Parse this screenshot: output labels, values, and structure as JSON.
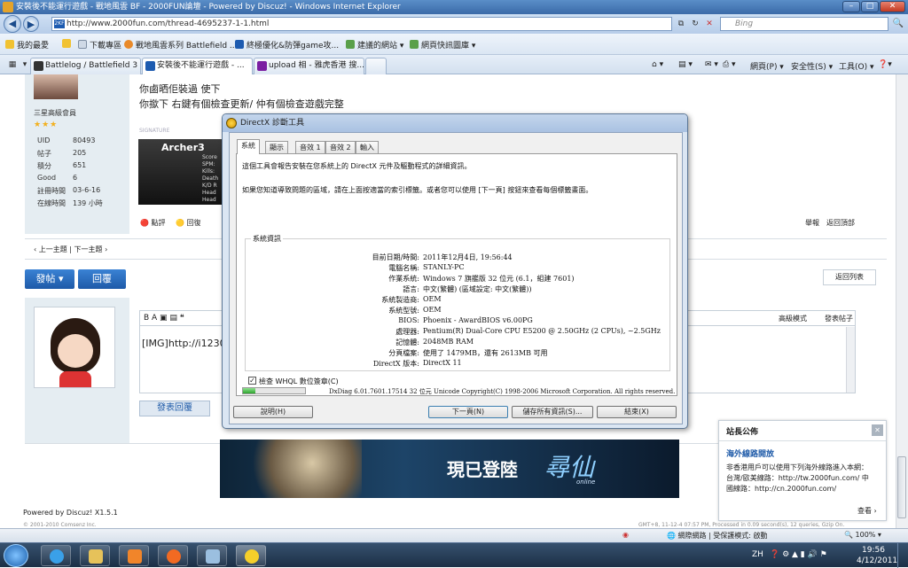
{
  "browser": {
    "title": "安裝後不能運行遊戲 - 戰地風雲 BF - 2000FUN論壇 - Powered by Discuz! - Windows Internet Explorer",
    "window_buttons": {
      "minimize": "–",
      "maximize": "□",
      "close": "✕"
    },
    "address": "http://www.2000fun.com/thread-4695237-1-1.html",
    "address_favicon": "2KF",
    "search_placeholder": "Bing",
    "favorites": [
      {
        "label": "我的最愛"
      },
      {
        "label": "下載專區"
      },
      {
        "label": "戰地風雲系列 Battlefield ..."
      },
      {
        "label": "終極優化&防彈game攻..."
      },
      {
        "label": "建議的網站 ▾"
      },
      {
        "label": "網頁快訊圖庫 ▾"
      }
    ],
    "tabs": [
      {
        "label": "Battlelog / Battlefield 3"
      },
      {
        "label": "安裝後不能運行遊戲 - ..."
      },
      {
        "label": "upload 相 - 雅虎香港 搜..."
      }
    ],
    "tools": {
      "page": "網頁(P) ▾",
      "safety": "安全性(S) ▾",
      "tools": "工具(O) ▾",
      "help": "❓▾"
    }
  },
  "forum": {
    "post_text_1": "你鹵晒佢裝過 使下",
    "post_text_2": "你撳下 右鍵有個檢查更新/ 仲有個檢查遊戲完整",
    "user_rank": "三星高級會員",
    "stars": "★★★",
    "stats": [
      {
        "k": "UID",
        "v": "80493"
      },
      {
        "k": "帖子",
        "v": "205"
      },
      {
        "k": "積分",
        "v": "651"
      },
      {
        "k": "Good",
        "v": "6"
      },
      {
        "k": "註冊時間",
        "v": "03-6-16"
      },
      {
        "k": "在線時間",
        "v": "139 小時"
      }
    ],
    "signature_label": "SIGNATURE",
    "sig_name": "Archer3",
    "sig_lines": [
      "Score",
      "SPM:",
      "Kills:",
      "Death",
      "K/D R",
      "Head",
      "Head"
    ],
    "rate": "點評",
    "reply_action": "回復",
    "report": "舉報",
    "back_top": "返回頂部",
    "prev_next": "‹ 上一主題 | 下一主題 ›",
    "post_btn": "發帖 ▾",
    "reply_btn": "回覆",
    "back_list": "返回列表",
    "editor_toolbar": "B A ▣ ▤ ❝",
    "advanced": "高級模式",
    "send": "發表帖子",
    "editor_text": "[IMG]http://i1230",
    "submit_reply": "發表回覆",
    "powered": "Powered by Discuz! X1.5.1",
    "copyright": "© 2001-2010 Comsenz Inc.",
    "gmt": "GMT+8, 11-12-4 07:57 PM, Processed in 0.09 second(s), 12 queries, Gzip On."
  },
  "dxdiag": {
    "title": "DirectX 診斷工具",
    "tabs": [
      "系統",
      "顯示",
      "音效 1",
      "音效 2",
      "輸入"
    ],
    "intro1": "這個工具會報告安裝在您系統上的 DirectX 元件及驅動程式的詳細資訊。",
    "intro2": "如果您知道導致問題的區域，請在上面按適當的索引標籤。或者您可以使用 [下一頁] 按鈕來查看每個標籤畫面。",
    "group_title": "系統資訊",
    "rows": [
      {
        "k": "目前日期/時間:",
        "v": "2011年12月4日, 19:56:44"
      },
      {
        "k": "電腦名稱:",
        "v": "STANLY-PC"
      },
      {
        "k": "作業系統:",
        "v": "Windows 7 旗艦版 32 位元 (6.1，組建 7601)"
      },
      {
        "k": "語言:",
        "v": "中文(繁體) (區域設定: 中文(繁體))"
      },
      {
        "k": "系統製造商:",
        "v": "OEM"
      },
      {
        "k": "系統型號:",
        "v": "OEM"
      },
      {
        "k": "BIOS:",
        "v": "Phoenix - AwardBIOS v6.00PG"
      },
      {
        "k": "處理器:",
        "v": "Pentium(R) Dual-Core  CPU      E5200  @ 2.50GHz (2 CPUs), ~2.5GHz"
      },
      {
        "k": "記憶體:",
        "v": "2048MB RAM"
      },
      {
        "k": "分頁檔案:",
        "v": "使用了 1479MB，還有 2613MB 可用"
      },
      {
        "k": "DirectX 版本:",
        "v": "DirectX 11"
      }
    ],
    "whql": "檢查 WHQL 數位簽章(C)",
    "progress": 0.2,
    "version_line": "DxDiag 6.01.7601.17514 32 位元 Unicode  Copyright(C) 1998-2006 Microsoft Corporation.  All rights reserved.",
    "buttons": {
      "help": "說明(H)",
      "next": "下一頁(N)",
      "save": "儲存所有資訊(S)...",
      "exit": "結束(X)"
    }
  },
  "notice": {
    "title": "站長公佈",
    "close": "✕",
    "headline": "海外線路開放",
    "body1": "非香港用戶可以使用下列海外線路進入本網：",
    "body2": "台灣/歐美線路：http://tw.2000fun.com/ 中",
    "body3": "國線路：http://cn.2000fun.com/",
    "more": "查看 ›"
  },
  "banner": {
    "text": "現已登陸",
    "logo": "尋仙",
    "logo_sub": "online"
  },
  "status": {
    "zone": "網際網路 | 受保護模式: 啟動",
    "zoom": "100%"
  },
  "taskbar": {
    "lang": "ZH",
    "time": "19:56",
    "date": "4/12/2011"
  },
  "colors": {
    "accent": "#1e5aa8",
    "panel": "#e5edf2",
    "dialog": "#f0f0f0"
  }
}
